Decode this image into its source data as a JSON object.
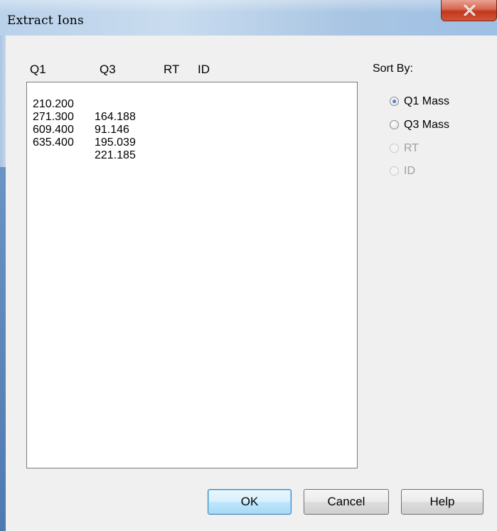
{
  "window": {
    "title": "Extract Ions",
    "close_glyph": "X"
  },
  "list": {
    "headers": {
      "q1": "Q1",
      "q3": "Q3",
      "rt": "RT",
      "id": "ID"
    },
    "rows": [
      {
        "q1": "210.200",
        "q3": "164.188"
      },
      {
        "q1": "271.300",
        "q3": "91.146"
      },
      {
        "q1": "609.400",
        "q3": "195.039"
      },
      {
        "q1": "635.400",
        "q3": "221.185"
      }
    ]
  },
  "sort": {
    "label": "Sort By:",
    "options": [
      {
        "label": "Q1 Mass",
        "selected": true,
        "enabled": true
      },
      {
        "label": "Q3 Mass",
        "selected": false,
        "enabled": true
      },
      {
        "label": "RT",
        "selected": false,
        "enabled": false
      },
      {
        "label": "ID",
        "selected": false,
        "enabled": false
      }
    ]
  },
  "buttons": {
    "ok": "OK",
    "cancel": "Cancel",
    "help": "Help"
  },
  "colors": {
    "accent": "#3c7fb1",
    "close": "#c2391c"
  }
}
